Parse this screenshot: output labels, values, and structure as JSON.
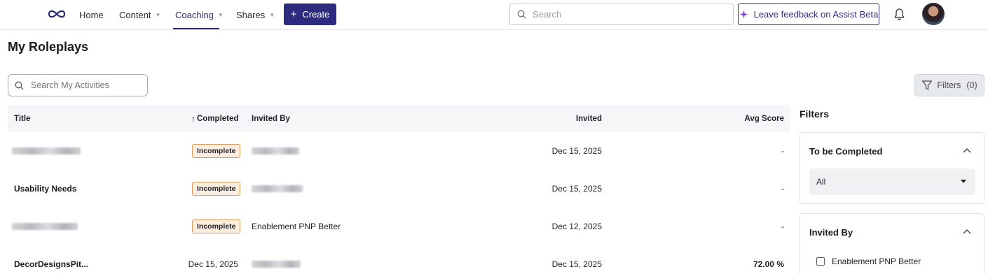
{
  "nav": {
    "items": [
      {
        "label": "Home"
      },
      {
        "label": "Content"
      },
      {
        "label": "Coaching"
      },
      {
        "label": "Shares"
      }
    ],
    "create_label": "Create",
    "search_placeholder": "Search",
    "feedback_label": "Leave feedback on Assist Beta"
  },
  "page": {
    "title": "My Roleplays",
    "search_placeholder": "Search My Activities",
    "filters_button": {
      "label": "Filters",
      "count": "(0)"
    }
  },
  "table": {
    "headers": {
      "title": "Title",
      "completed": "Completed",
      "invited_by": "Invited By",
      "invited": "Invited",
      "avg_score": "Avg Score"
    },
    "rows": [
      {
        "title": "",
        "title_blurred": true,
        "completed": "Incomplete",
        "completed_is_badge": true,
        "invited_by": "",
        "invited_by_blurred": true,
        "invited": "Dec 15, 2025",
        "avg_score": "-"
      },
      {
        "title": "Usability Needs",
        "title_blurred": false,
        "completed": "Incomplete",
        "completed_is_badge": true,
        "invited_by": "",
        "invited_by_blurred": true,
        "invited": "Dec 15, 2025",
        "avg_score": "-"
      },
      {
        "title": "",
        "title_blurred": true,
        "completed": "Incomplete",
        "completed_is_badge": true,
        "invited_by": "Enablement PNP Better",
        "invited_by_blurred": false,
        "invited": "Dec 12, 2025",
        "avg_score": "-"
      },
      {
        "title": "DecorDesignsPit...",
        "title_blurred": false,
        "completed": "Dec 15, 2025",
        "completed_is_badge": false,
        "invited_by": "",
        "invited_by_blurred": true,
        "invited": "Dec 15, 2025",
        "avg_score": "72.00 %"
      }
    ]
  },
  "filters_panel": {
    "heading": "Filters",
    "to_be_completed": {
      "title": "To be Completed",
      "selected": "All"
    },
    "invited_by": {
      "title": "Invited By",
      "options": [
        "Enablement PNP Better"
      ]
    }
  },
  "colors": {
    "brand": "#2d2b80",
    "badge_border": "#e09a5c",
    "badge_fill": "#fdeee0",
    "feedback_star": "#7b3fe4"
  }
}
